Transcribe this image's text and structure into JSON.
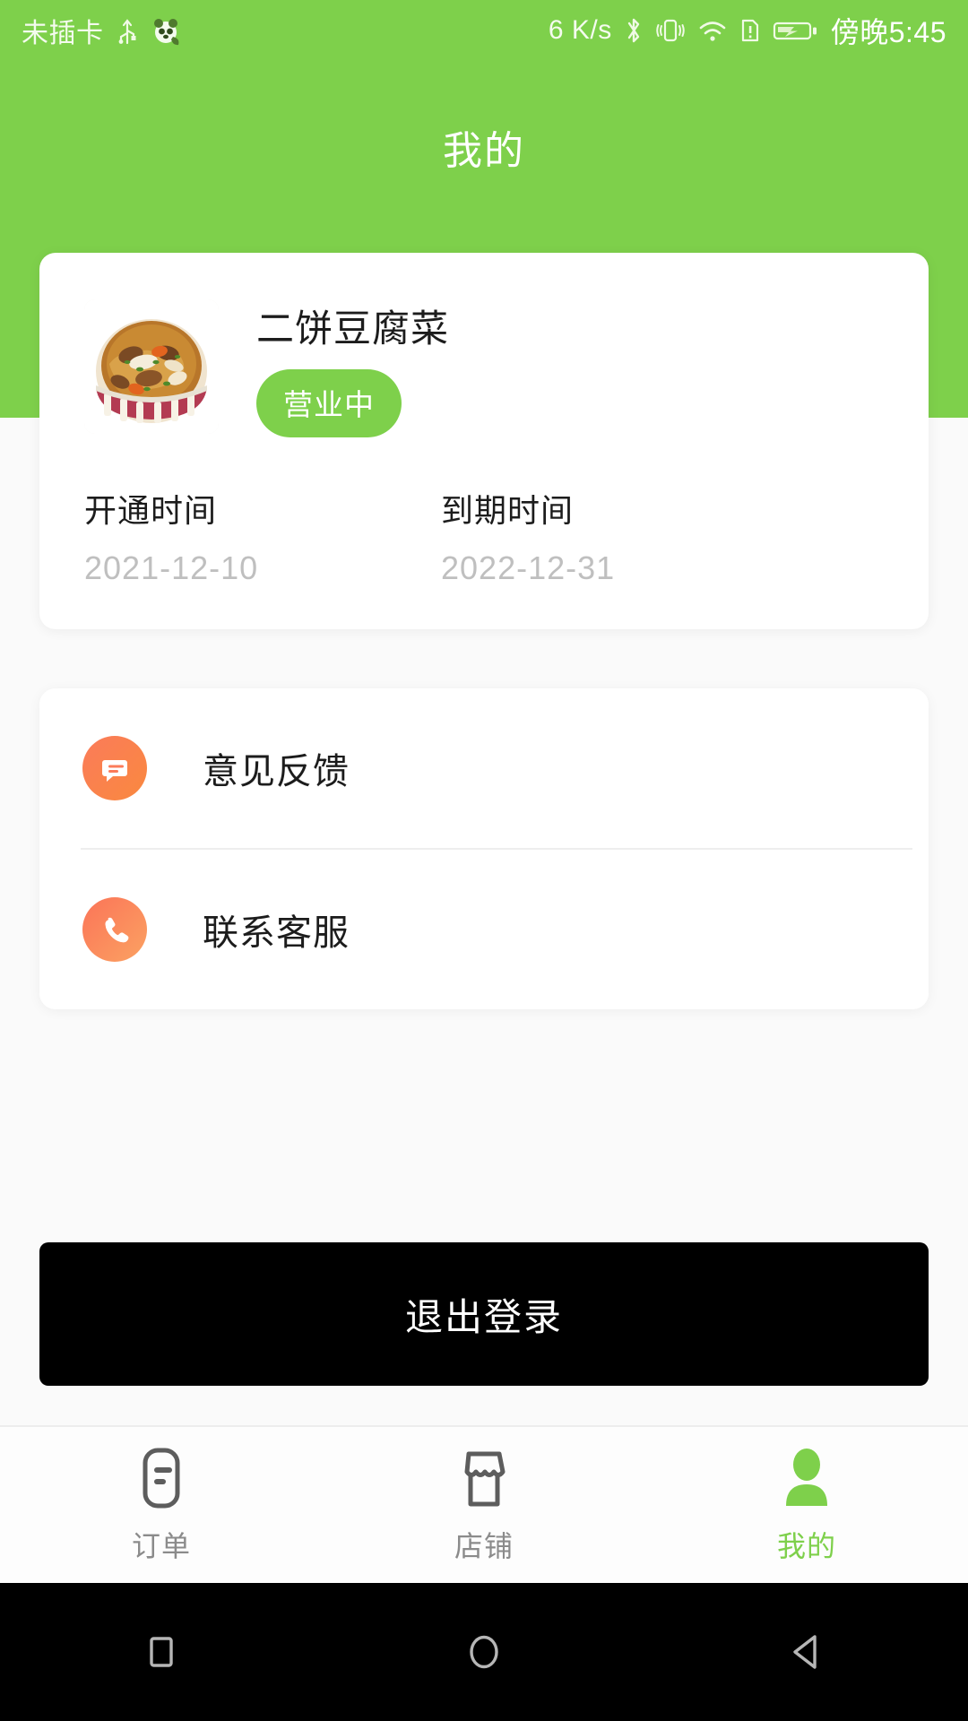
{
  "statusbar": {
    "carrier": "未插卡",
    "usb_icon": "usb-icon",
    "app_icon": "panda-app-icon",
    "network_speed": "6 K/s",
    "bluetooth_icon": "bluetooth-icon",
    "vibrate_icon": "vibrate-icon",
    "wifi_icon": "wifi-icon",
    "sim_alert_icon": "sim-alert-icon",
    "battery_icon": "battery-charging-icon",
    "time": "傍晚5:45"
  },
  "header": {
    "title": "我的",
    "accent_color": "#7ed04b"
  },
  "profile": {
    "shop_photo_icon": "noodle-bowl-photo",
    "shop_name": "二饼豆腐菜",
    "status_badge": "营业中",
    "badge_color": "#7ed04b",
    "fields": [
      {
        "label": "开通时间",
        "value": "2021-12-10"
      },
      {
        "label": "到期时间",
        "value": "2022-12-31"
      }
    ]
  },
  "menu": {
    "items": [
      {
        "label": "意见反馈",
        "icon": "chat-bubble-icon",
        "icon_color": "#fb7b5a"
      },
      {
        "label": "联系客服",
        "icon": "phone-icon",
        "icon_color": "#fb7458"
      }
    ]
  },
  "logout": {
    "label": "退出登录"
  },
  "tabbar": {
    "items": [
      {
        "label": "订单",
        "icon": "receipt-icon",
        "active": false
      },
      {
        "label": "店铺",
        "icon": "store-icon",
        "active": false
      },
      {
        "label": "我的",
        "icon": "person-icon",
        "active": true
      }
    ],
    "active_color": "#7ed04b",
    "inactive_color": "#8b8b8b"
  },
  "navbar": {
    "recents": "square-recents-icon",
    "home": "circle-home-icon",
    "back": "triangle-back-icon"
  }
}
